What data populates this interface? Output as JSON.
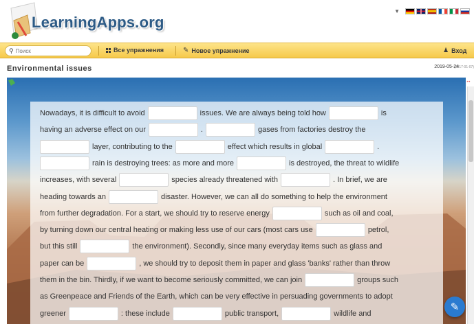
{
  "header": {
    "logo_text": "LearningApps.org",
    "lang_arrow": "▼"
  },
  "flags": [
    {
      "name": "german-flag-icon",
      "colors": [
        "#000000",
        "#dd0000",
        "#ffce00"
      ]
    },
    {
      "name": "uk-flag-icon",
      "colors": [
        "#012169",
        "#c8102e",
        "#ffffff"
      ]
    },
    {
      "name": "spanish-flag-icon",
      "colors": [
        "#aa151b",
        "#f1bf00",
        "#aa151b"
      ]
    },
    {
      "name": "french-flag-icon",
      "colors": [
        "#0055a4",
        "#ffffff",
        "#ef4135"
      ]
    },
    {
      "name": "italian-flag-icon",
      "colors": [
        "#009246",
        "#ffffff",
        "#ce2b37"
      ]
    },
    {
      "name": "russian-flag-icon",
      "colors": [
        "#ffffff",
        "#0039a6",
        "#d52b1e"
      ]
    }
  ],
  "nav": {
    "search_placeholder": "Поиск",
    "all_exercises": "Все упражнения",
    "new_exercise": "Новое упражнение",
    "login": "Вход"
  },
  "title": {
    "text": "Environmental issues",
    "date": "2019-05-24",
    "date_created": "(2017-01-07)"
  },
  "exercise": {
    "lines": [
      [
        "Nowadays, it is difficult to avoid",
        "",
        "issues. We are always being told how",
        "",
        "is"
      ],
      [
        "having an adverse effect on our",
        "",
        ".",
        "",
        "gases from factories destroy the"
      ],
      [
        "",
        "layer, contributing to the",
        "",
        "effect which results in global",
        "",
        "."
      ],
      [
        "",
        "rain is destroying trees: as more and more",
        "",
        "is destroyed, the threat to wildlife"
      ],
      [
        "increases, with several",
        "",
        "species already threatened with",
        "",
        ". In brief, we are"
      ],
      [
        "heading towards an",
        "",
        "disaster. However, we can all do something to help the environment"
      ],
      [
        "from further degradation. For a start, we should try to reserve energy",
        "",
        "such as oil and coal,"
      ],
      [
        "by turning down our central heating or making less use of our cars (most cars use",
        "",
        "petrol,"
      ],
      [
        "but this still",
        "",
        "the environment). Secondly, since many everyday items such as glass and"
      ],
      [
        "paper can be",
        "",
        ", we should try to deposit them in paper and glass 'banks' rather than throw"
      ],
      [
        "them in the bin. Thirdly, if we want to become seriously committed, we can join",
        "",
        "groups such"
      ],
      [
        "as Greenpeace and Friends of the Earth, which can be very effective in persuading governments to adopt"
      ],
      [
        "greener",
        "",
        ": these include",
        "",
        "public transport,",
        "",
        "wildlife and"
      ]
    ]
  },
  "fab": {
    "icon": "✎"
  }
}
